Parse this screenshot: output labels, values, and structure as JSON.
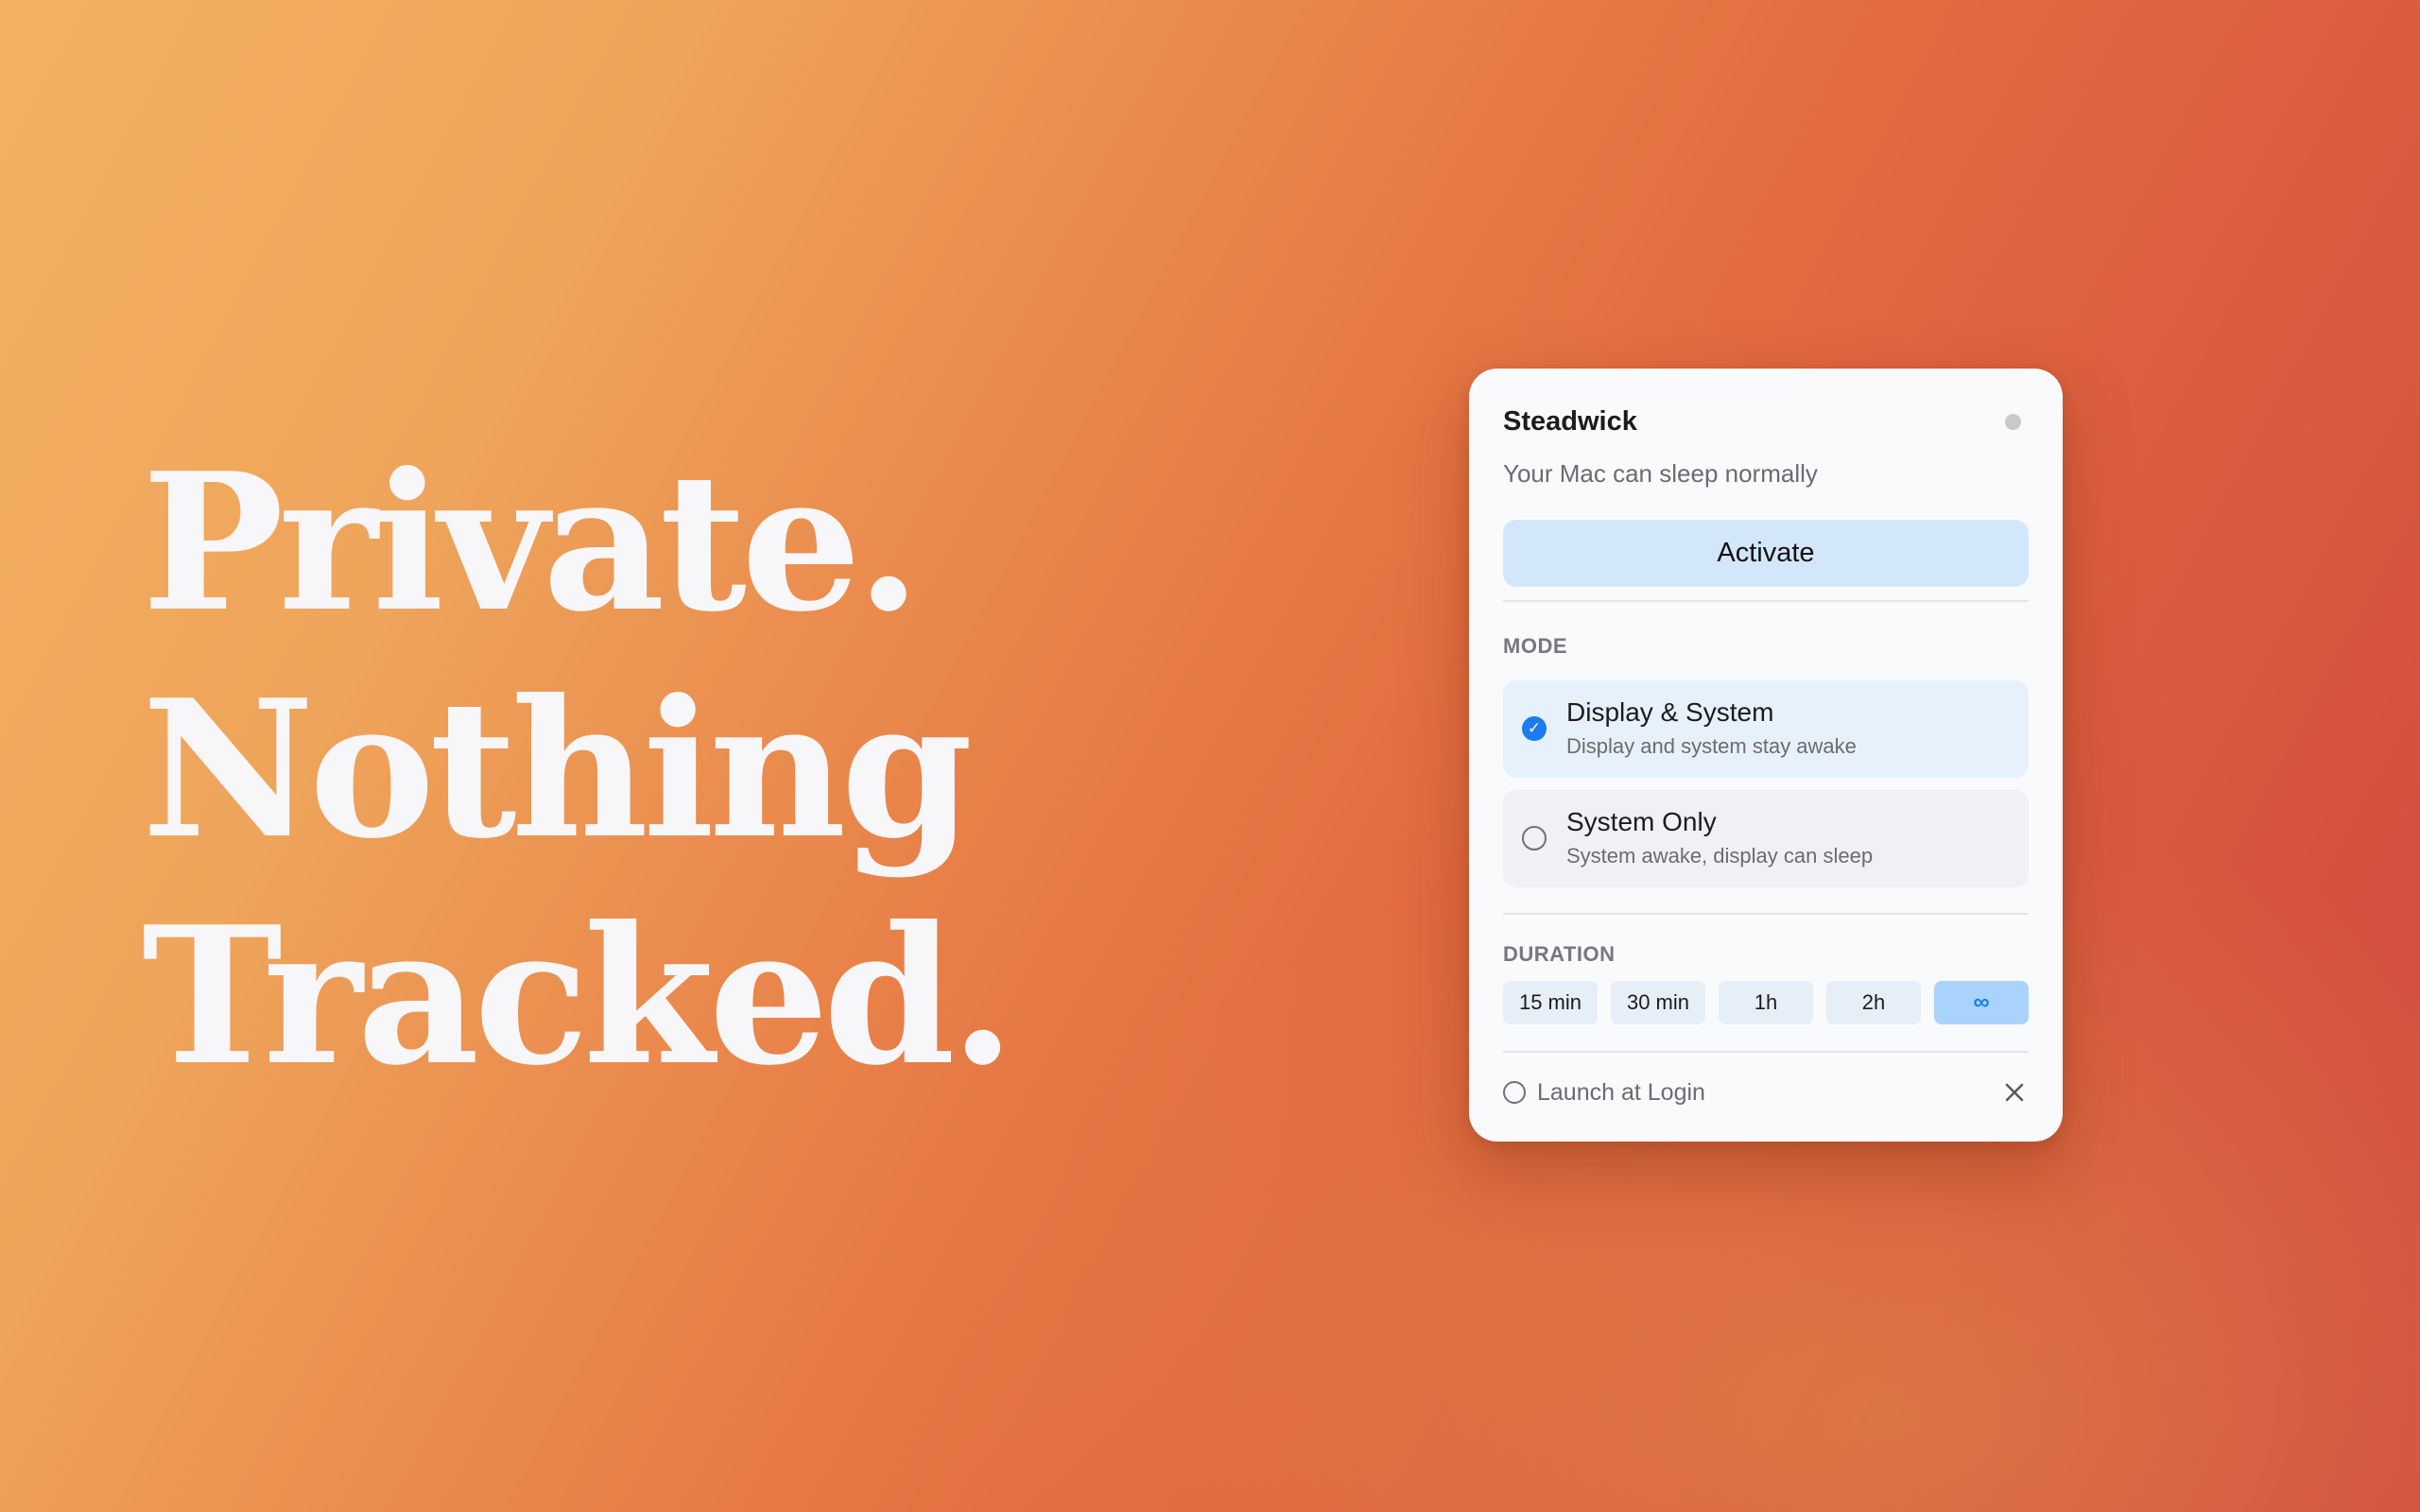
{
  "headline": {
    "lines": [
      "Private.",
      "Nothing",
      "Tracked."
    ],
    "color": "#f7f6f8"
  },
  "panel": {
    "app_name": "Steadwick",
    "status_indicator": "gray-dot",
    "status_text": "Your Mac can sleep normally",
    "activate_label": "Activate",
    "mode": {
      "section_label": "MODE",
      "options": [
        {
          "title": "Display & System",
          "description": "Display and system stay awake",
          "selected": true
        },
        {
          "title": "System Only",
          "description": "System awake, display can sleep",
          "selected": false
        }
      ]
    },
    "duration": {
      "section_label": "DURATION",
      "options": [
        "15 min",
        "30 min",
        "1h",
        "2h",
        "∞"
      ],
      "selected": "∞"
    },
    "footer": {
      "launch_at_login_label": "Launch at Login",
      "launch_at_login_checked": false,
      "close_icon": "close-icon"
    }
  },
  "colors": {
    "accent": "#1a7cf0",
    "activate_bg": "#d3e7fb",
    "panel_bg": "#f9fafc",
    "gradient_start": "#f4b063",
    "gradient_end": "#cf4743"
  }
}
